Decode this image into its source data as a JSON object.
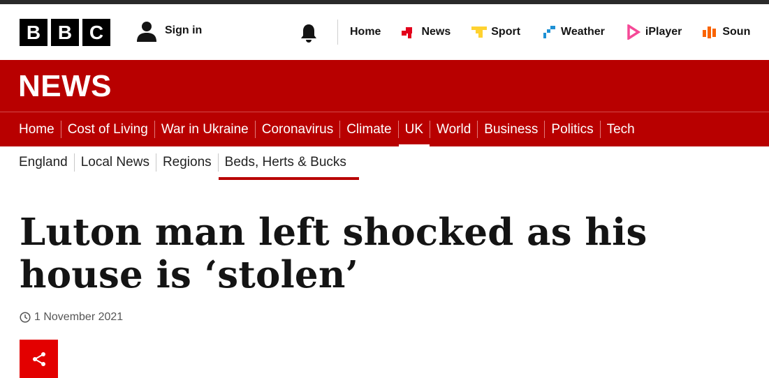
{
  "brand": {
    "logo_letters": [
      "B",
      "B",
      "C"
    ],
    "section_title": "NEWS",
    "accent_color": "#b80000"
  },
  "masthead": {
    "sign_in_label": "Sign in",
    "notifications_icon": "bell-icon",
    "nav": [
      {
        "label": "Home",
        "icon": ""
      },
      {
        "label": "News",
        "icon": "news-icon",
        "icon_color": "#e3001b"
      },
      {
        "label": "Sport",
        "icon": "sport-icon",
        "icon_color": "#ffd230"
      },
      {
        "label": "Weather",
        "icon": "weather-icon",
        "icon_color": "#1e90d4"
      },
      {
        "label": "iPlayer",
        "icon": "iplayer-icon",
        "icon_color": "#f54997"
      },
      {
        "label": "Soun",
        "icon": "sounds-icon",
        "icon_color": "#fa6400"
      }
    ]
  },
  "primary_nav": [
    "Home",
    "Cost of Living",
    "War in Ukraine",
    "Coronavirus",
    "Climate",
    "UK",
    "World",
    "Business",
    "Politics",
    "Tech"
  ],
  "primary_nav_active": "UK",
  "secondary_nav": [
    "England",
    "Local News",
    "Regions",
    "Beds, Herts & Bucks"
  ],
  "secondary_nav_active": "Beds, Herts & Bucks",
  "article": {
    "headline": "Luton man left shocked as his house is ‘stolen’",
    "date": "1 November 2021",
    "share_icon": "share-icon",
    "share_color": "#e30000"
  }
}
